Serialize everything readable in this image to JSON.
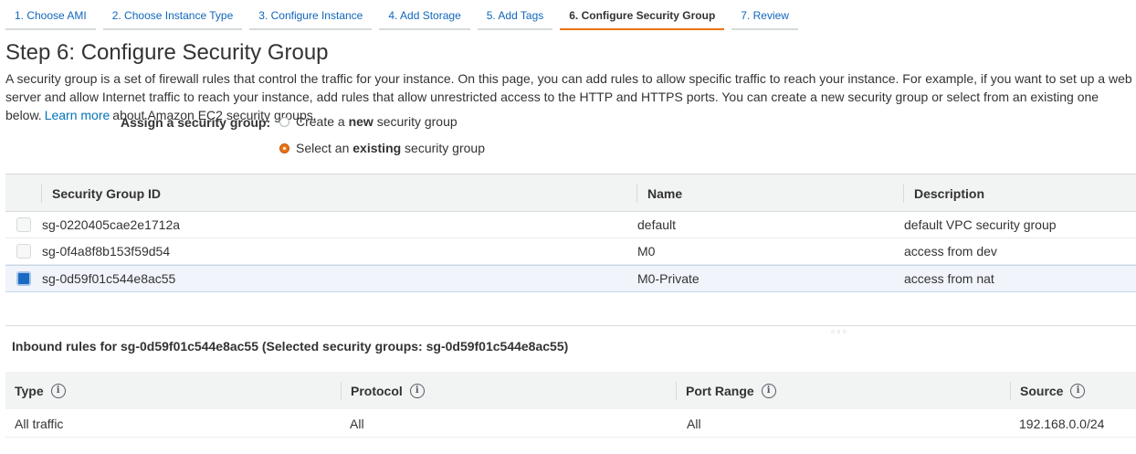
{
  "wizard_tabs": [
    {
      "label": "1. Choose AMI"
    },
    {
      "label": "2. Choose Instance Type"
    },
    {
      "label": "3. Configure Instance"
    },
    {
      "label": "4. Add Storage"
    },
    {
      "label": "5. Add Tags"
    },
    {
      "label": "6. Configure Security Group"
    },
    {
      "label": "7. Review"
    }
  ],
  "active_tab": "6. Configure Security Group",
  "page": {
    "title": "Step 6: Configure Security Group",
    "description_part1": "A security group is a set of firewall rules that control the traffic for your instance. On this page, you can add rules to allow specific traffic to reach your instance. For example, if you want to set up a web server and allow Internet traffic to reach your instance, add rules that allow unrestricted access to the HTTP and HTTPS ports. You can create a new security group or select from an existing one below.",
    "learn_more": "Learn more",
    "description_part2": "about Amazon EC2 security groups."
  },
  "assign": {
    "label": "Assign a security group:",
    "option_create_prefix": "Create a ",
    "option_create_bold": "new",
    "option_create_suffix": " security group",
    "option_existing_prefix": "Select an ",
    "option_existing_bold": "existing",
    "option_existing_suffix": " security group",
    "selected": "existing"
  },
  "security_groups": {
    "headers": {
      "id": "Security Group ID",
      "name": "Name",
      "description": "Description"
    },
    "rows": [
      {
        "id": "sg-0220405cae2e1712a",
        "name": "default",
        "description": "default VPC security group",
        "checked": false
      },
      {
        "id": "sg-0f4a8f8b153f59d54",
        "name": "M0",
        "description": "access from dev",
        "checked": false
      },
      {
        "id": "sg-0d59f01c544e8ac55",
        "name": "M0-Private",
        "description": "access from nat",
        "checked": true
      }
    ]
  },
  "inbound": {
    "title": "Inbound rules for sg-0d59f01c544e8ac55 (Selected security groups: sg-0d59f01c544e8ac55)",
    "headers": {
      "type": "Type",
      "protocol": "Protocol",
      "port_range": "Port Range",
      "source": "Source"
    },
    "info_glyph": "i",
    "rows": [
      {
        "type": "All traffic",
        "protocol": "All",
        "port_range": "All",
        "source": "192.168.0.0/24"
      }
    ]
  },
  "colors": {
    "link": "#0073bb",
    "active_tab_underline": "#ec7211",
    "selected_checkbox": "#1a6ac4",
    "selected_row": "#f1f4fb"
  },
  "icons": [
    "radio-unchecked-icon",
    "radio-checked-icon",
    "checkbox-icon",
    "info-icon",
    "resize-grip-icon"
  ]
}
